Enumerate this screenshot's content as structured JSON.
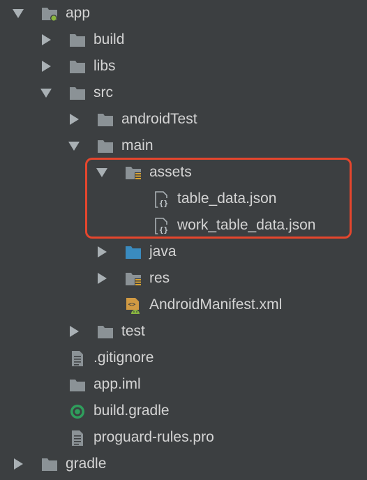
{
  "tree": {
    "items": [
      {
        "label": "app",
        "icon": "module-folder-icon",
        "state": "expanded"
      },
      {
        "label": "build",
        "icon": "folder-icon",
        "state": "collapsed"
      },
      {
        "label": "libs",
        "icon": "folder-icon",
        "state": "collapsed"
      },
      {
        "label": "src",
        "icon": "folder-icon",
        "state": "expanded"
      },
      {
        "label": "androidTest",
        "icon": "folder-icon",
        "state": "collapsed"
      },
      {
        "label": "main",
        "icon": "folder-icon",
        "state": "expanded"
      },
      {
        "label": "assets",
        "icon": "resources-folder-icon",
        "state": "expanded"
      },
      {
        "label": "table_data.json",
        "icon": "json-file-icon",
        "state": "leaf"
      },
      {
        "label": "work_table_data.json",
        "icon": "json-file-icon",
        "state": "leaf"
      },
      {
        "label": "java",
        "icon": "source-folder-icon",
        "state": "collapsed"
      },
      {
        "label": "res",
        "icon": "resources-folder-icon",
        "state": "collapsed"
      },
      {
        "label": "AndroidManifest.xml",
        "icon": "android-manifest-icon",
        "state": "leaf"
      },
      {
        "label": "test",
        "icon": "folder-icon",
        "state": "collapsed"
      },
      {
        "label": ".gitignore",
        "icon": "text-file-icon",
        "state": "leaf"
      },
      {
        "label": "app.iml",
        "icon": "iml-file-icon",
        "state": "leaf"
      },
      {
        "label": "build.gradle",
        "icon": "gradle-file-icon",
        "state": "leaf"
      },
      {
        "label": "proguard-rules.pro",
        "icon": "text-file-icon",
        "state": "leaf"
      },
      {
        "label": "gradle",
        "icon": "folder-icon",
        "state": "collapsed"
      }
    ]
  },
  "colors": {
    "background": "#3c3f41",
    "text": "#d4d4d4",
    "folder": "#8b9296",
    "source_folder": "#3a8bbf",
    "highlight": "#e5462d"
  }
}
